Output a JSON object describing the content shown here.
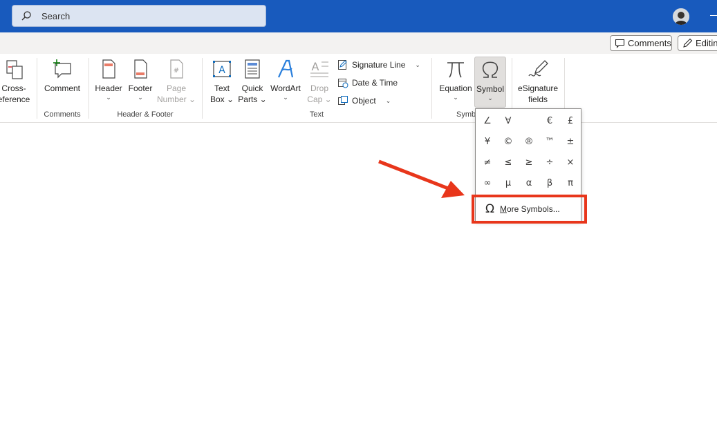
{
  "titlebar": {
    "search_placeholder": "Search",
    "search_icon": "search-icon",
    "avatar_icon": "user-avatar"
  },
  "commandbar": {
    "comments_label": "Comments",
    "editing_label": "Editing",
    "comments_icon": "comment-icon",
    "editing_icon": "pencil-icon"
  },
  "ribbon": {
    "links": {
      "cross_reference_line1": "Cross-",
      "cross_reference_line2": "eference"
    },
    "comments_group": {
      "label": "Comments",
      "comment_button": "Comment"
    },
    "header_footer_group": {
      "label": "Header & Footer",
      "header_button": "Header",
      "footer_button": "Footer",
      "page_number_line1": "Page",
      "page_number_line2": "Number"
    },
    "text_group": {
      "label": "Text",
      "text_box_line1": "Text",
      "text_box_line2": "Box",
      "quick_parts_line1": "Quick",
      "quick_parts_line2": "Parts",
      "wordart_button": "WordArt",
      "drop_cap_line1": "Drop",
      "drop_cap_line2": "Cap",
      "signature_line": "Signature Line",
      "date_time": "Date & Time",
      "object": "Object"
    },
    "symbols_group": {
      "label": "Symb",
      "equation_button": "Equation",
      "symbol_button": "Symbol"
    },
    "esignature_group": {
      "line1": "eSignature",
      "line2": "fields"
    }
  },
  "symbol_dropdown": {
    "symbols": [
      "∠",
      "∀",
      "",
      "€",
      "£",
      "¥",
      "©",
      "®",
      "™",
      "±",
      "≠",
      "≤",
      "≥",
      "÷",
      "×",
      "∞",
      "µ",
      "α",
      "β",
      "π"
    ],
    "more_symbols_underline": "M",
    "more_symbols_rest": "ore Symbols...",
    "more_icon_glyph": "Ω"
  },
  "colors": {
    "titlebar": "#185abd",
    "annotation": "#e8361b"
  }
}
